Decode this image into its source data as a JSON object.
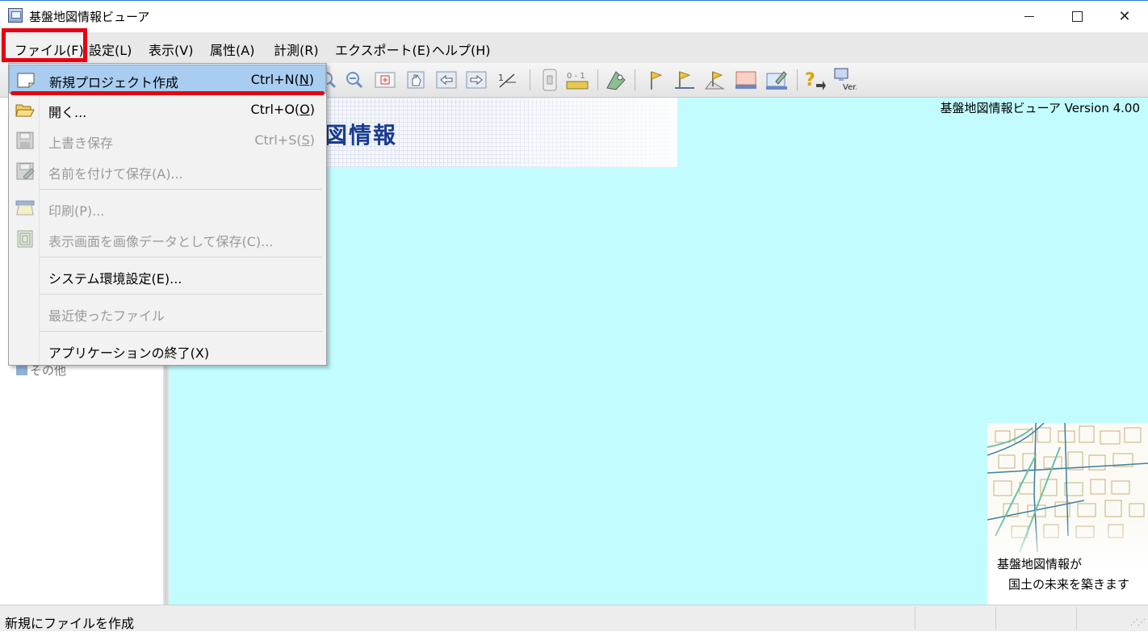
{
  "window": {
    "title": "基盤地図情報ビューア"
  },
  "menubar": {
    "items": [
      "ファイル(F)",
      "設定(L)",
      "表示(V)",
      "属性(A)",
      "計測(R)",
      "エクスポート(E)",
      "ヘルプ(H)"
    ]
  },
  "file_menu": {
    "new_project": {
      "label": "新規プロジェクト作成",
      "shortcut_prefix": "Ctrl+N(",
      "shortcut_key": "N",
      "shortcut_suffix": ")"
    },
    "open": {
      "label": "開く...",
      "shortcut_prefix": "Ctrl+O(",
      "shortcut_key": "O",
      "shortcut_suffix": ")"
    },
    "save": {
      "label": "上書き保存",
      "shortcut_prefix": "Ctrl+S(",
      "shortcut_key": "S",
      "shortcut_suffix": ")"
    },
    "save_as": {
      "label": "名前を付けて保存(A)..."
    },
    "print": {
      "label": "印刷(P)..."
    },
    "save_image": {
      "label": "表示画面を画像データとして保存(C)..."
    },
    "system_settings": {
      "label": "システム環境設定(E)..."
    },
    "recent_files": {
      "label": "最近使ったファイル"
    },
    "exit": {
      "label": "アプリケーションの終了(X)"
    }
  },
  "left_panel": {
    "tree_item": "その他"
  },
  "main": {
    "banner_title": "図情報",
    "version": "基盤地図情報ビューア Version 4.00",
    "slogan_line1": "基盤地図情報が",
    "slogan_line2": "国土の未来を築きます"
  },
  "statusbar": {
    "text": "新規にファイルを作成"
  },
  "colors": {
    "map_background": "#c2fcfe",
    "highlight": "#a9cdf0",
    "annotation_red": "#e60012"
  }
}
